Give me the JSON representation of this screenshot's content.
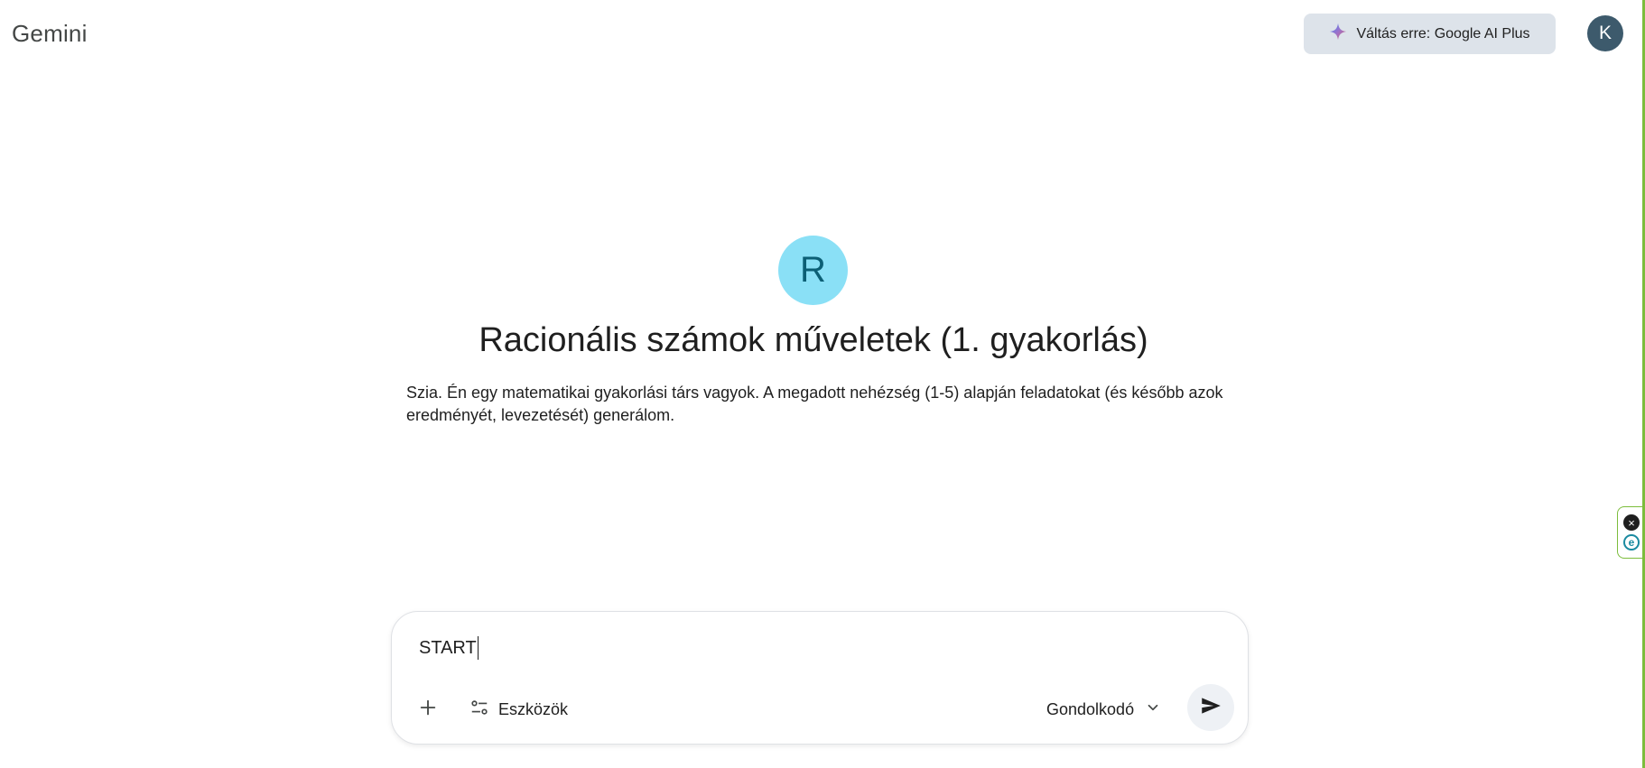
{
  "header": {
    "app_name": "Gemini",
    "upgrade_label": "Váltás erre: Google AI Plus",
    "avatar_letter": "K"
  },
  "gem": {
    "avatar_letter": "R",
    "title": "Racionális számok műveletek (1. gyakorlás)",
    "description": "Szia. Én egy matematikai gyakorlási társ vagyok. A megadott nehézség (1-5) alapján feladatokat (és később azok eredményét, levezetését) generálom."
  },
  "composer": {
    "input_value": "START",
    "tools_label": "Eszközök",
    "mode_label": "Gondolkodó"
  },
  "colors": {
    "accent": "#8ae0f6",
    "upgrade_bg": "#dde3ea",
    "user_avatar": "#3d5a6c",
    "extension_border": "#7cbd3c"
  },
  "icons": {
    "upgrade": "sparkle-icon",
    "add": "plus-icon",
    "tools": "sliders-icon",
    "mode": "chevron-down-icon",
    "send": "send-icon",
    "widget_close": "close-icon",
    "widget_ext": "extension-icon"
  }
}
